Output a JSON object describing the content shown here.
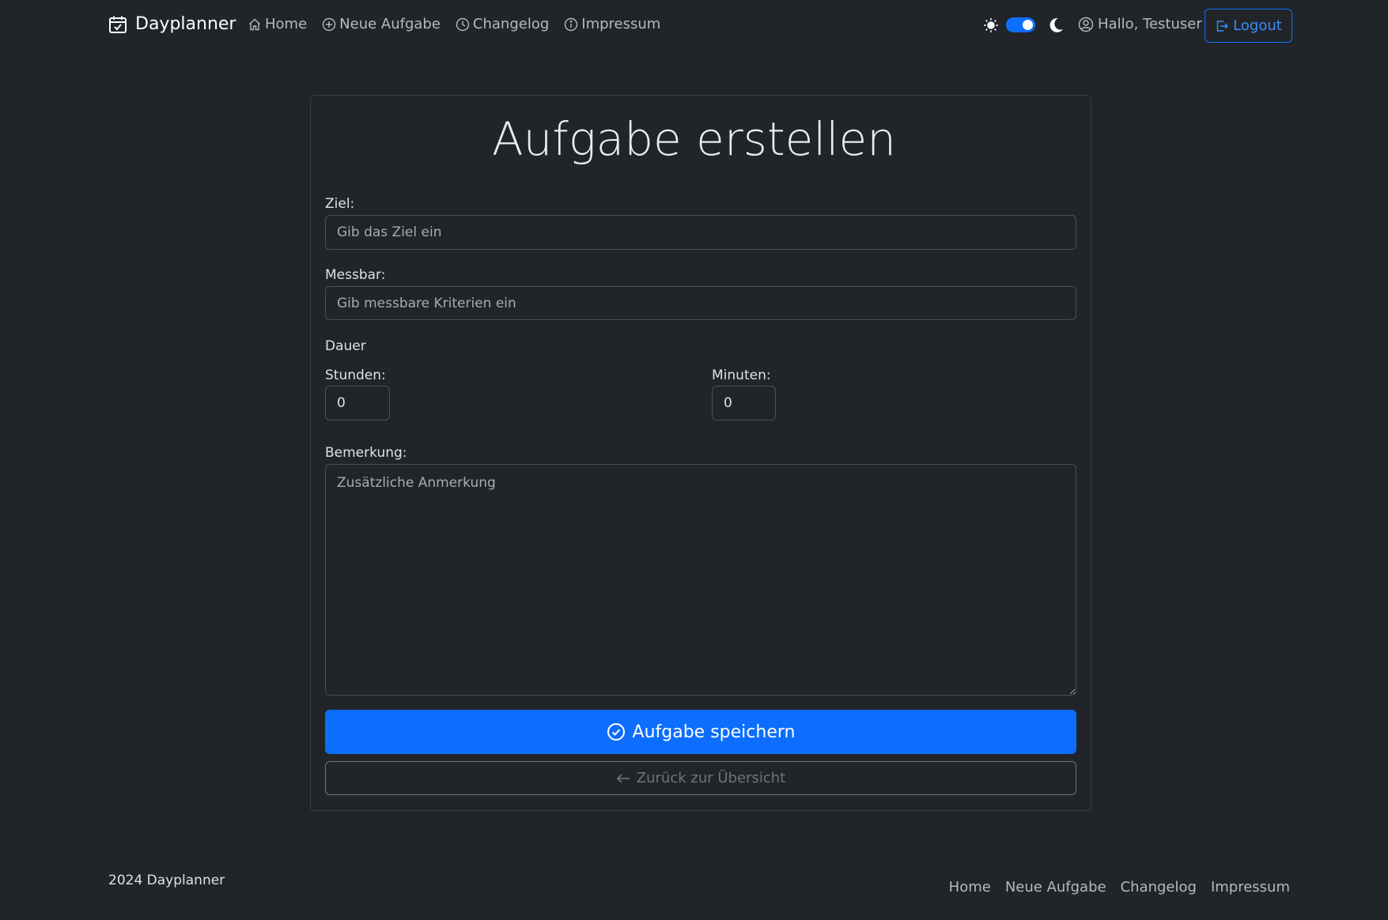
{
  "navbar": {
    "brand": "Dayplanner",
    "links": [
      {
        "label": "Home",
        "icon": "home-icon"
      },
      {
        "label": "Neue Aufgabe",
        "icon": "plus-circle-icon"
      },
      {
        "label": "Changelog",
        "icon": "clock-icon"
      },
      {
        "label": "Impressum",
        "icon": "info-circle-icon"
      }
    ],
    "greeting": "Hallo, Testuser",
    "logout_label": "Logout",
    "theme_toggle_dark": true
  },
  "form": {
    "title": "Aufgabe erstellen",
    "goal_label": "Ziel:",
    "goal_placeholder": "Gib das Ziel ein",
    "measurable_label": "Messbar:",
    "measurable_placeholder": "Gib messbare Kriterien ein",
    "duration_heading": "Dauer",
    "hours_label": "Stunden:",
    "hours_value": "0",
    "minutes_label": "Minuten:",
    "minutes_value": "0",
    "remark_label": "Bemerkung:",
    "remark_placeholder": "Zusätzliche Anmerkung",
    "save_label": "Aufgabe speichern",
    "back_label": "Zurück zur Übersicht"
  },
  "footer": {
    "copyright": "2024 Dayplanner",
    "links": [
      "Home",
      "Neue Aufgabe",
      "Changelog",
      "Impressum"
    ]
  },
  "colors": {
    "background": "#212529",
    "primary": "#0d6efd",
    "border": "#495057",
    "secondary": "#6c757d"
  }
}
